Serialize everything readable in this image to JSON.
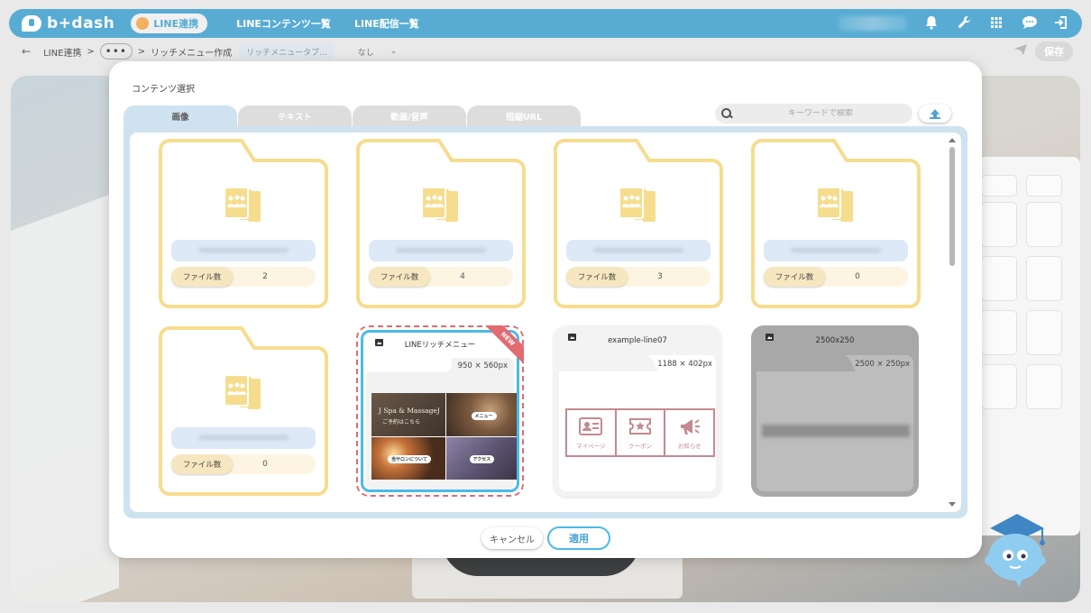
{
  "app": {
    "logo_text": "b+dash",
    "line_pill": "LINE連携",
    "nav": [
      "LINEコンテンツ一覧",
      "LINE配信一覧"
    ],
    "icons": [
      "bell-icon",
      "wrench-icon",
      "grid-icon",
      "chat-icon",
      "logout-icon"
    ]
  },
  "breadcrumb": {
    "back": "←",
    "item1": "LINE連携",
    "sep": ">",
    "more": "•••",
    "item2": "リッチメニュー作成",
    "type": "リッチメニュータブ...",
    "select_value": "なし",
    "select_chevron": "⌄",
    "save": "保存"
  },
  "modal": {
    "title": "コンテンツ選択",
    "tabs": [
      "画像",
      "テキスト",
      "動画/音声",
      "短縮URL"
    ],
    "active_tab": 0,
    "search_placeholder": "キーワードで検索",
    "folders": [
      {
        "count_label": "ファイル数",
        "count": "2"
      },
      {
        "count_label": "ファイル数",
        "count": "4"
      },
      {
        "count_label": "ファイル数",
        "count": "3"
      },
      {
        "count_label": "ファイル数",
        "count": "0"
      },
      {
        "count_label": "ファイル数",
        "count": "0"
      }
    ],
    "images": [
      {
        "title": "LINEリッチメニュー",
        "dims": "950 × 560px",
        "badge": "NEW",
        "selected": true,
        "photo_text_1": "J Spa & MassageJ",
        "photo_text_2": "ご予約はこちら",
        "chip_menu": "メニュー",
        "chip_salon": "当サロンについて",
        "chip_access": "アクセス"
      },
      {
        "title": "example-line07",
        "dims": "1188 × 402px",
        "cells": [
          "マイページ",
          "クーポン",
          "お知らせ"
        ]
      },
      {
        "title": "2500x250",
        "dims": "2500 × 250px"
      }
    ],
    "cancel": "キャンセル",
    "apply": "適用"
  },
  "colors": {
    "brand": "#58acd3",
    "folder_outline": "#f6dd8e",
    "selected_border": "#4bbbe8",
    "selected_dash": "#e26a70",
    "rich_accent": "#c48a8f"
  }
}
